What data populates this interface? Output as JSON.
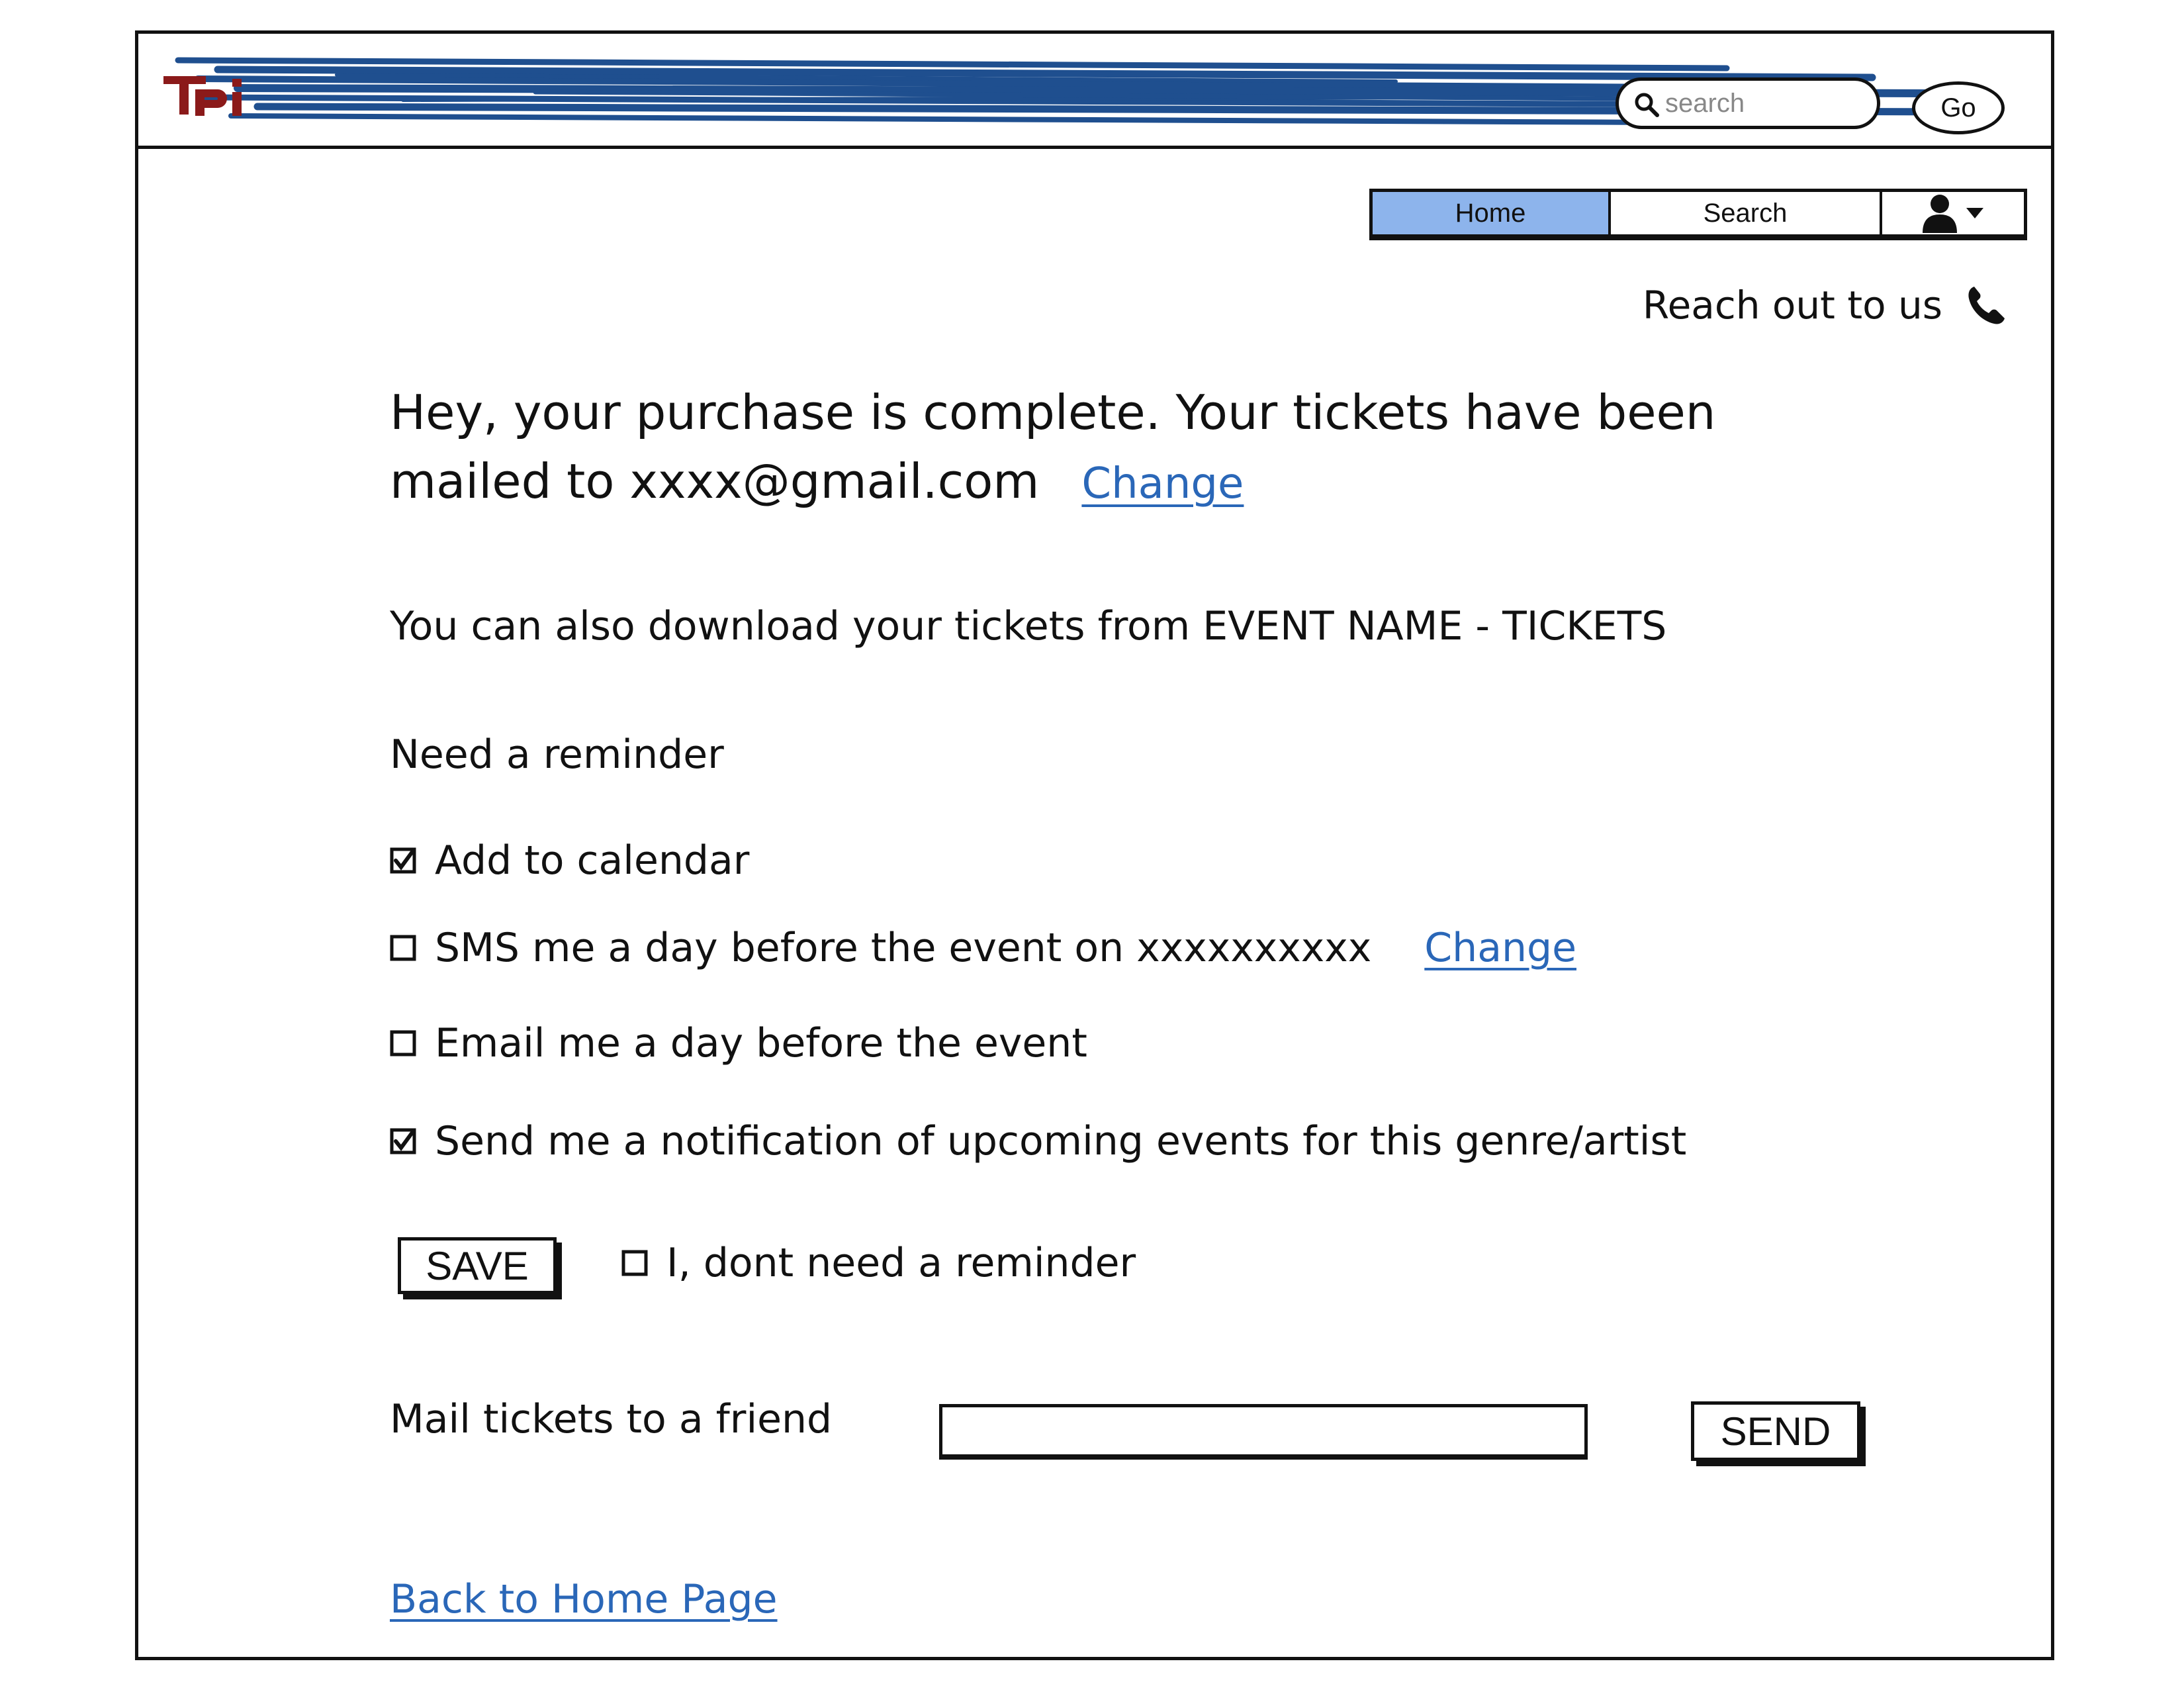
{
  "header": {
    "logo_text": "TPI",
    "search": {
      "placeholder": "search",
      "value": ""
    },
    "go_label": "Go"
  },
  "nav": {
    "tabs": [
      {
        "label": "Home",
        "active": true
      },
      {
        "label": "Search",
        "active": false
      }
    ],
    "user_menu_icon": "user-icon"
  },
  "contact": {
    "label": "Reach out to us",
    "icon": "phone-icon"
  },
  "main": {
    "headline_line1": "Hey, your purchase is complete. Your tickets have been",
    "headline_line2": "mailed to xxxx@gmail.com",
    "change_email_link": "Change",
    "download_text": "You can also download your tickets from EVENT NAME - TICKETS",
    "reminder_heading": "Need a reminder",
    "options": [
      {
        "label": "Add to calendar",
        "checked": true
      },
      {
        "label": "SMS me a day before the event on xxxxxxxxxx",
        "checked": false,
        "link": "Change"
      },
      {
        "label": "Email me a day before the event",
        "checked": false
      },
      {
        "label": "Send me a notification of upcoming events for this genre/artist",
        "checked": true
      }
    ],
    "save_label": "SAVE",
    "no_reminder_label": "I, dont need a reminder",
    "no_reminder_checked": false,
    "mail_friend_label": "Mail tickets to a friend",
    "mail_friend_value": "",
    "send_label": "SEND",
    "back_link": "Back to Home Page"
  },
  "colors": {
    "accent_blue": "#2a67b8",
    "nav_active_bg": "#8db4ec",
    "logo_red": "#8b1a1a",
    "scribble_blue": "#1f4f8f"
  }
}
